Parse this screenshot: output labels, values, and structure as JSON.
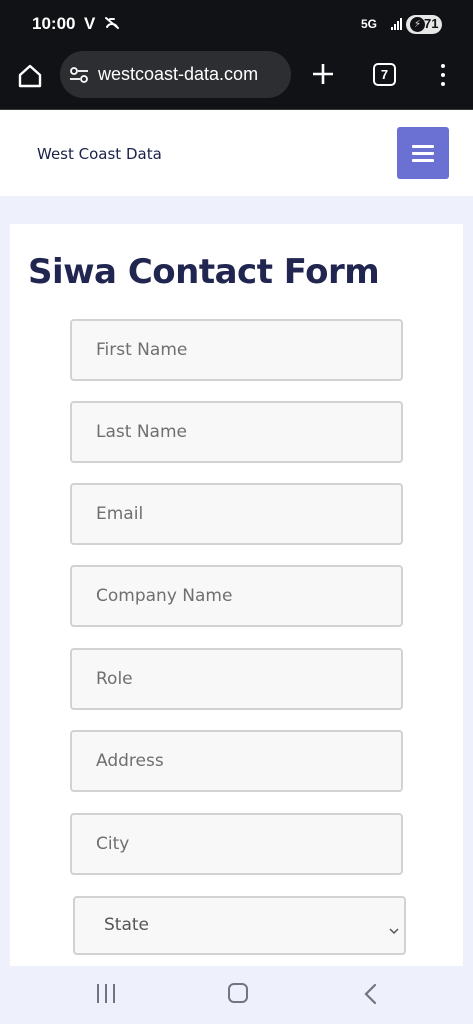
{
  "status_bar": {
    "time": "10:00",
    "carrier_badge": "V",
    "network": "5G",
    "battery_level": "71",
    "icons": [
      "mute-icon",
      "signal-icon",
      "battery-charging-icon"
    ]
  },
  "browser": {
    "url": "westcoast-data.com",
    "tab_count": "7",
    "icons": [
      "home-icon",
      "site-settings-icon",
      "new-tab-plus-icon",
      "tab-switcher-icon",
      "overflow-menu-icon"
    ]
  },
  "site": {
    "title": "West Coast Data",
    "menu_icon": "hamburger-menu-icon",
    "accent_color": "#6a71d3"
  },
  "form": {
    "heading": "Siwa Contact Form",
    "fields": {
      "first_name": {
        "value": "",
        "placeholder": "First Name"
      },
      "last_name": {
        "value": "",
        "placeholder": "Last Name"
      },
      "email": {
        "value": "",
        "placeholder": "Email"
      },
      "company": {
        "value": "",
        "placeholder": "Company Name"
      },
      "role": {
        "value": "",
        "placeholder": "Role"
      },
      "address": {
        "value": "",
        "placeholder": "Address"
      },
      "city": {
        "value": "",
        "placeholder": "City"
      }
    },
    "state_select": {
      "selected": "State"
    }
  },
  "navigation_bar": {
    "icons": [
      "recent-apps-icon",
      "home-nav-icon",
      "back-nav-icon"
    ]
  }
}
